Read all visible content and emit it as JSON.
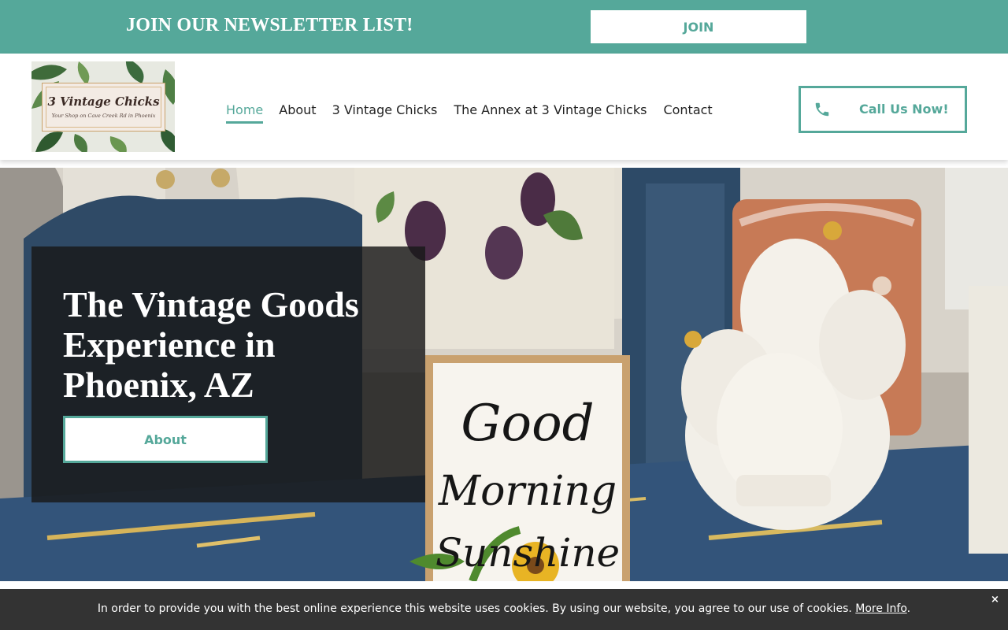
{
  "colors": {
    "accent": "#55a89a",
    "header_bg": "#ffffff",
    "panel_bg": "#191919",
    "cookie_bg": "#333333"
  },
  "newsletter": {
    "title": "JOIN OUR NEWSLETTER LIST!",
    "join_label": "JOIN"
  },
  "header": {
    "logo": {
      "title": "3 Vintage Chicks",
      "tagline": "Your Shop on Cave Creek Rd in Phoenix"
    },
    "nav": [
      {
        "label": "Home",
        "active": true
      },
      {
        "label": "About",
        "active": false
      },
      {
        "label": "3 Vintage Chicks",
        "active": false
      },
      {
        "label": "The Annex at 3 Vintage Chicks",
        "active": false
      },
      {
        "label": "Contact",
        "active": false
      }
    ],
    "call_label": "Call Us Now!",
    "call_icon": "phone-icon"
  },
  "hero": {
    "title": "The Vintage Goods Experience in Phoenix, AZ",
    "button_label": "About",
    "sign_text": [
      "Good",
      "Morning",
      "Sunshine"
    ]
  },
  "cookie": {
    "text": "In order to provide you with the best online experience this website uses cookies. By using our website, you agree to our use of cookies.",
    "link_label": "More Info",
    "trailing": ".",
    "close_label": "×"
  }
}
